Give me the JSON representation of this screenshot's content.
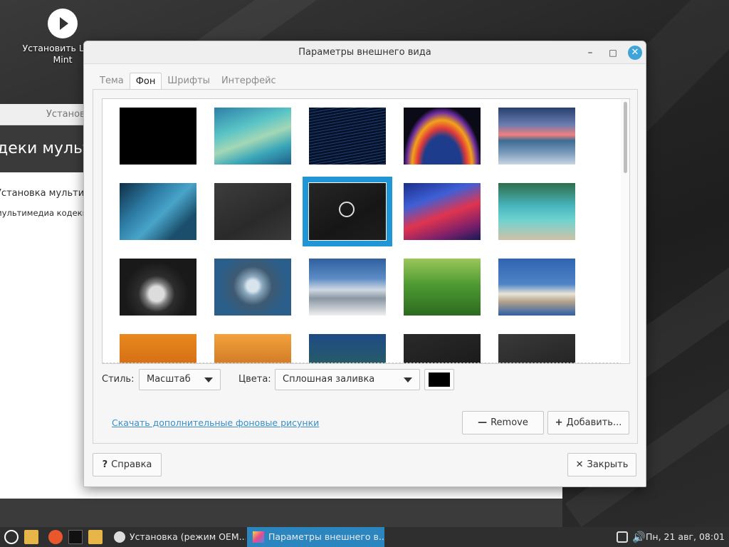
{
  "desktop": {
    "icon_label": "Установить Linux Mint"
  },
  "bg_window": {
    "title": "Установ",
    "hero": "деки мульт",
    "line1": "Установка мультимед",
    "line2": "мультимедиа кодеки н"
  },
  "dialog": {
    "title": "Параметры внешнего вида",
    "tabs": [
      "Тема",
      "Фон",
      "Шрифты",
      "Интерфейс"
    ],
    "active_tab": "Фон",
    "style_label": "Стиль:",
    "style_value": "Масштаб",
    "colors_label": "Цвета:",
    "colors_value": "Сплошная заливка",
    "swatch_color": "#000000",
    "link_text": "Скачать дополнительные фоновые рисунки",
    "remove_label": "Remove",
    "add_label": "Добавить...",
    "help_label": "Справка",
    "close_label": "Закрыть",
    "accent": "#2196d6"
  },
  "taskbar": {
    "tasks": [
      "Установка (режим OEM...",
      "Параметры внешнего в..."
    ],
    "clock": "Пн, 21 авг, 08:01"
  }
}
